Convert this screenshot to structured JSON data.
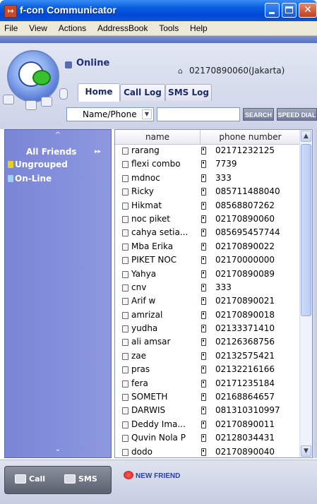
{
  "window": {
    "title": "f-con Communicator"
  },
  "menu": [
    "File",
    "View",
    "Actions",
    "AddressBook",
    "Tools",
    "Help"
  ],
  "status": {
    "text": "Online",
    "phone_location": "02170890060(Jakarta)"
  },
  "tabs": [
    {
      "label": "Home",
      "active": true
    },
    {
      "label": "Call Log",
      "active": false
    },
    {
      "label": "SMS Log",
      "active": false
    }
  ],
  "search": {
    "field_type": "Name/Phone",
    "query": "",
    "search_label": "SEARCH",
    "speed_dial_label": "SPEED DIAL"
  },
  "sidebar": {
    "all_friends": "All Friends",
    "groups": [
      {
        "label": "Ungrouped",
        "icon_color": "#e8d020"
      },
      {
        "label": "On-Line",
        "icon_color": "#9ed2f2"
      }
    ]
  },
  "contacts": {
    "columns": [
      "name",
      "phone number"
    ],
    "rows": [
      {
        "name": "rarang",
        "phone": "02171232125"
      },
      {
        "name": "flexi combo",
        "phone": "7739"
      },
      {
        "name": "mdnoc",
        "phone": "333"
      },
      {
        "name": "Ricky",
        "phone": "085711488040"
      },
      {
        "name": "Hikmat",
        "phone": "08568807262"
      },
      {
        "name": "noc piket",
        "phone": "02170890060"
      },
      {
        "name": "cahya setia...",
        "phone": "085695457744"
      },
      {
        "name": "Mba Erika",
        "phone": "02170890022"
      },
      {
        "name": "PIKET NOC",
        "phone": "02170000000"
      },
      {
        "name": "Yahya",
        "phone": "02170890089"
      },
      {
        "name": "cnv",
        "phone": "333"
      },
      {
        "name": "Arif w",
        "phone": "02170890021"
      },
      {
        "name": "amrizal",
        "phone": "02170890018"
      },
      {
        "name": "yudha",
        "phone": "02133371410"
      },
      {
        "name": "ali amsar",
        "phone": "02126368756"
      },
      {
        "name": "zae",
        "phone": "02132575421"
      },
      {
        "name": "pras",
        "phone": "02132216166"
      },
      {
        "name": "fera",
        "phone": "02171235184"
      },
      {
        "name": "SOMETH",
        "phone": "02168864657"
      },
      {
        "name": "DARWIS",
        "phone": "081310310997"
      },
      {
        "name": "Deddy Ima...",
        "phone": "02170890011"
      },
      {
        "name": "Quvin Nola P",
        "phone": "02128034431"
      },
      {
        "name": "dodo",
        "phone": "02170890040"
      }
    ]
  },
  "bottom": {
    "call_label": "Call",
    "sms_label": "SMS",
    "new_friend_label": "NEW FRIEND"
  },
  "colors": {
    "titlebar": "#0a55d8",
    "sidebar": "#8590dc",
    "accent": "#2b3fa8"
  }
}
